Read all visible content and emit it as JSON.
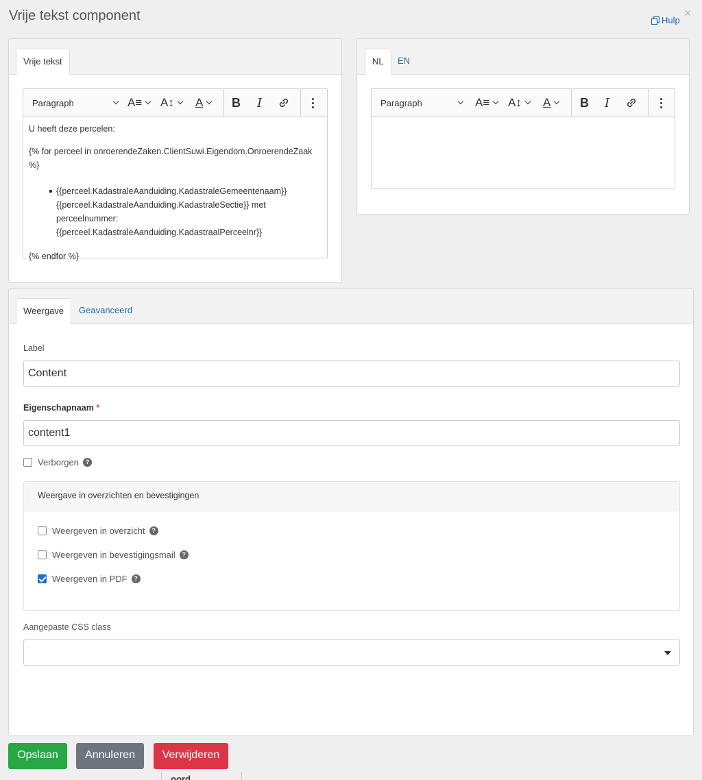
{
  "modal": {
    "title": "Vrije tekst component",
    "help_label": "Hulp",
    "close_label": "×"
  },
  "left_editor": {
    "tab_label": "Vrije tekst",
    "toolbar": {
      "heading": "Paragraph"
    },
    "content": {
      "line1": "U heeft deze percelen:",
      "line2": "{% for perceel in onroerendeZaken.ClientSuwi.Eigendom.OnroerendeZaak %}",
      "bullet_line1": "{{perceel.KadastraleAanduiding.KadastraleGemeentenaam}}",
      "bullet_line2": "{{perceel.KadastraleAanduiding.KadastraleSectie}} met",
      "bullet_line3": "perceelnummer:",
      "bullet_line4": "{{perceel.KadastraleAanduiding.KadastraalPerceelnr}}",
      "line3": "{% endfor %}"
    }
  },
  "right_editor": {
    "tabs": [
      "NL",
      "EN"
    ],
    "toolbar": {
      "heading": "Paragraph"
    }
  },
  "settings": {
    "tabs": [
      "Weergave",
      "Geavanceerd"
    ],
    "label_field": {
      "label": "Label",
      "value": "Content"
    },
    "property_field": {
      "label": "Eigenschapnaam",
      "required_mark": "*",
      "value": "content1"
    },
    "hidden": {
      "label": "Verborgen",
      "checked": false
    },
    "display_section": {
      "title": "Weergave in overzichten en bevestigingen",
      "options": [
        {
          "label": "Weergeven in overzicht",
          "checked": false
        },
        {
          "label": "Weergeven in bevestigingsmail",
          "checked": false
        },
        {
          "label": "Weergeven in PDF",
          "checked": true
        }
      ]
    },
    "css_class": {
      "label": "Aangepaste CSS class",
      "value": ""
    }
  },
  "buttons": {
    "save": "Opslaan",
    "cancel": "Annuleren",
    "delete": "Verwijderen"
  },
  "background_fragment": "oord",
  "colors": {
    "accent": "#1a6aa8",
    "save": "#28a745",
    "cancel": "#6c757d",
    "delete": "#dc3545",
    "checked": "#1f6fd1"
  }
}
